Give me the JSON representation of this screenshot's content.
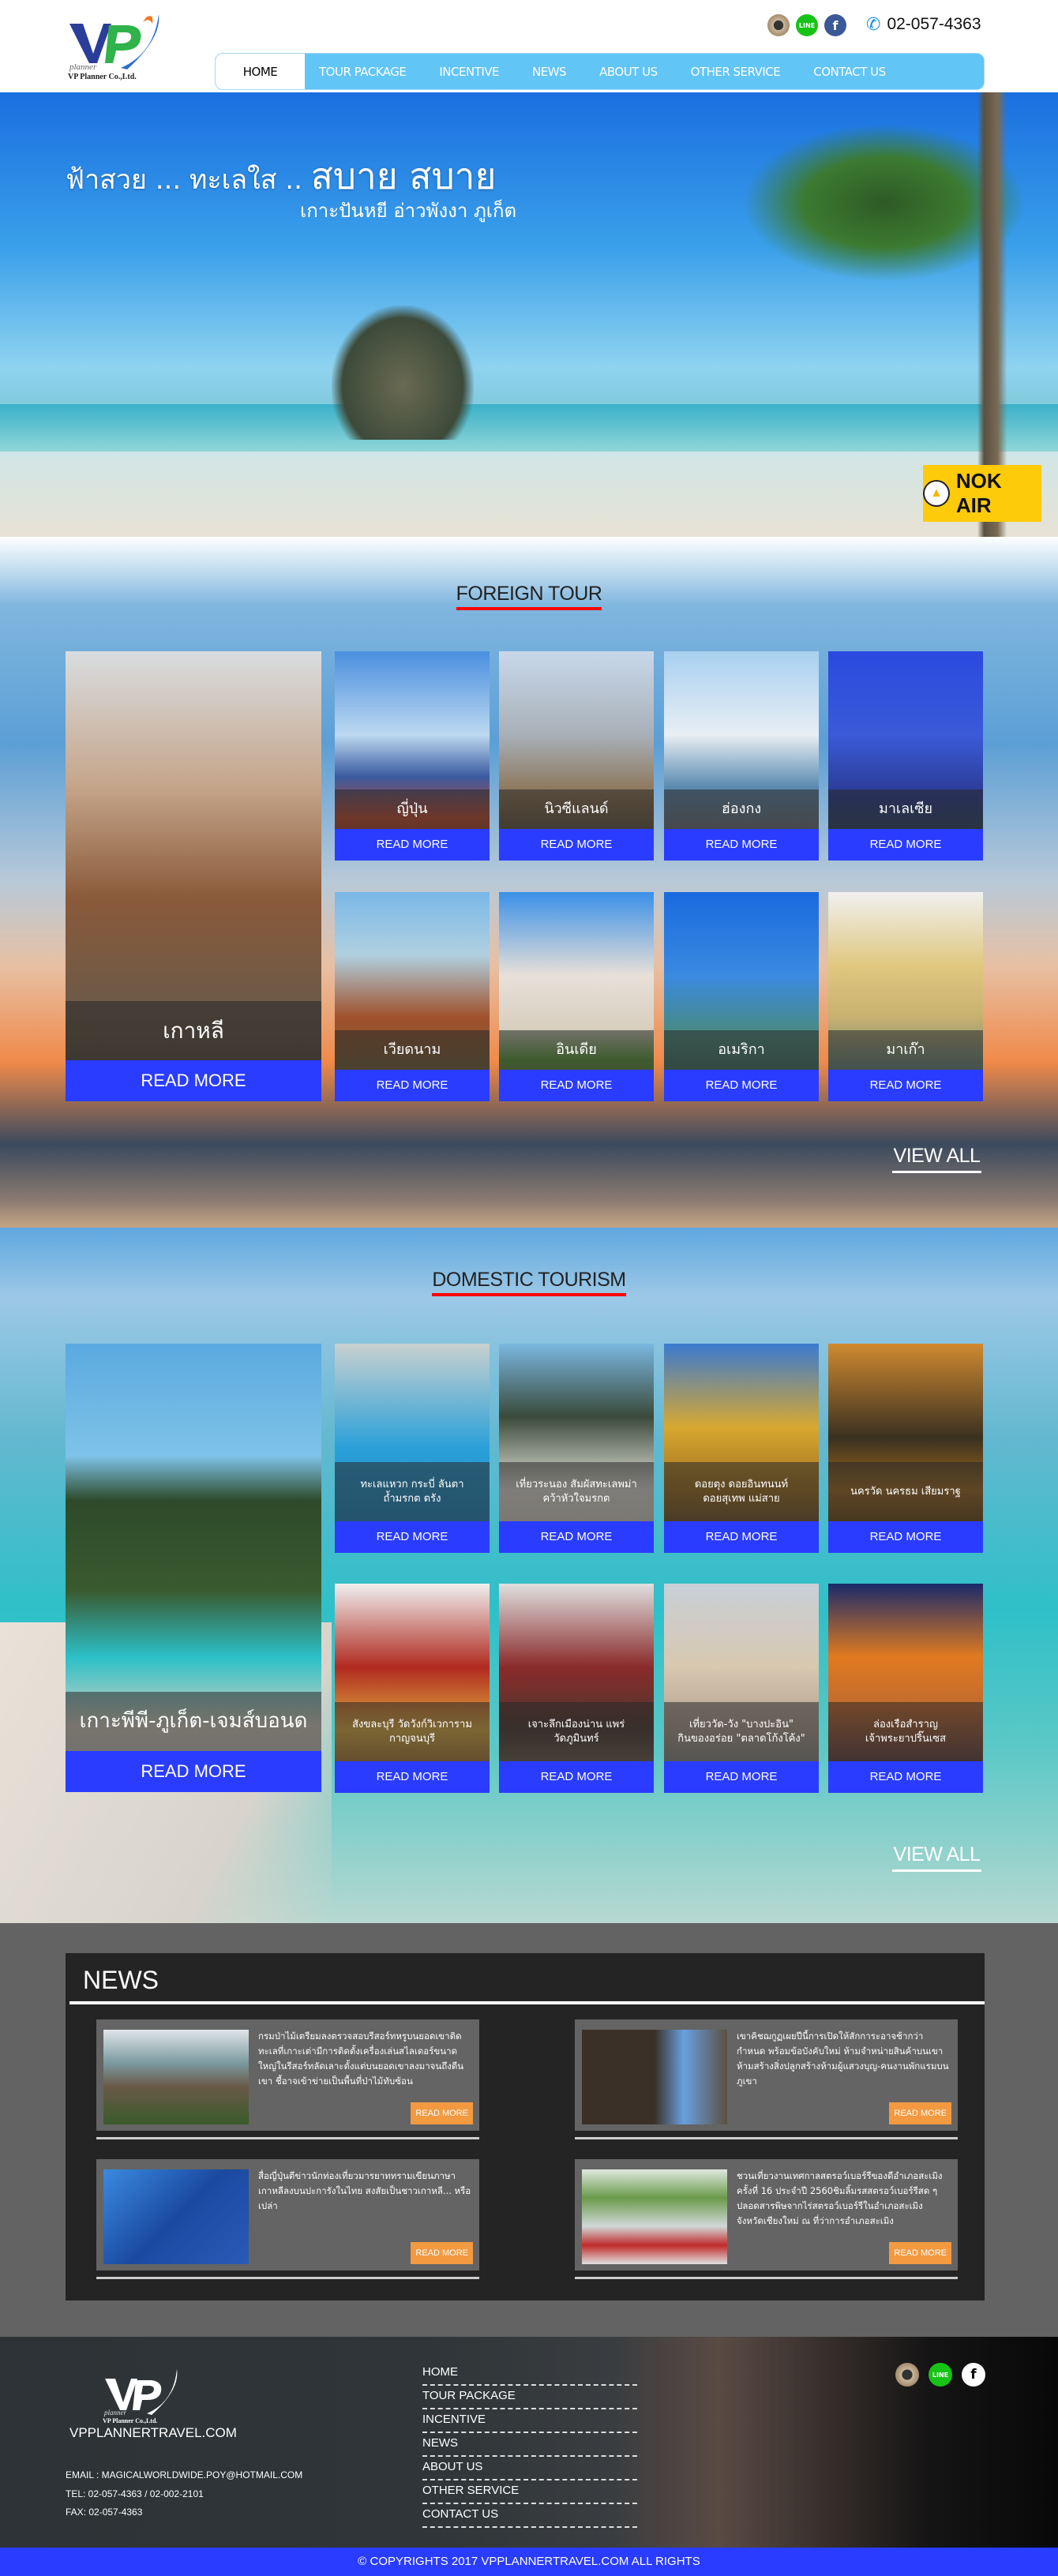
{
  "header": {
    "logo_text": "VP planner VP Planner Co.,Ltd.",
    "phone": "02-057-4363",
    "social": [
      "instagram-icon",
      "line-icon",
      "facebook-icon"
    ],
    "nav": [
      "HOME",
      "TOUR PACKAGE",
      "INCENTIVE",
      "NEWS",
      "ABOUT US",
      "OTHER SERVICE",
      "CONTACT US"
    ],
    "nav_active": "HOME",
    "nav_color": "#61c5f5"
  },
  "hero": {
    "line1_small": "ฟ้าสวย ... ทะเลใส ..",
    "line1_big": "สบาย สบาย",
    "line2": "เกาะปันหยี อ่าวพังงา   ภูเก็ต",
    "sponsor": "NOK AIR",
    "sponsor_color": "#fecb0b"
  },
  "foreign": {
    "title": "FOREIGN TOUR",
    "view_all": "VIEW ALL",
    "featured": {
      "name": "เกาหลี",
      "button": "READ MORE"
    },
    "cards": [
      {
        "name": "ญี่ปุ่น",
        "button": "READ MORE"
      },
      {
        "name": "นิวซีแลนด์",
        "button": "READ MORE"
      },
      {
        "name": "ฮ่องกง",
        "button": "READ MORE"
      },
      {
        "name": "มาเลเซีย",
        "button": "READ MORE"
      },
      {
        "name": "เวียดนาม",
        "button": "READ MORE"
      },
      {
        "name": "อินเดีย",
        "button": "READ MORE"
      },
      {
        "name": "อเมริกา",
        "button": "READ MORE"
      },
      {
        "name": "มาเก๊า",
        "button": "READ MORE"
      }
    ]
  },
  "domestic": {
    "title": "DOMESTIC TOURISM",
    "view_all": "VIEW ALL",
    "featured": {
      "name": "เกาะพีพี-ภูเก็ต-เจมส์บอนด",
      "button": "READ MORE"
    },
    "cards": [
      {
        "line1": "ทะเลแหวก กระบี่ ลันตา",
        "line2": "ถ้ำมรกต ตรัง",
        "button": "READ MORE"
      },
      {
        "line1": "เที่ยวระนอง สัมผัสทะเลพม่า",
        "line2": "คว้าหัวใจมรกต",
        "button": "READ MORE"
      },
      {
        "line1": "ดอยตุง ดอยอินทนนท์",
        "line2": "ดอยสุเทพ แม่สาย",
        "button": "READ MORE"
      },
      {
        "line1": "นครวัด นครธม เสียมราฐ",
        "line2": "",
        "button": "READ MORE"
      },
      {
        "line1": "สังขละบุรี วัดวังก์วิเวการาม",
        "line2": "กาญจนบุรี",
        "button": "READ MORE"
      },
      {
        "line1": "เจาะลึกเมืองน่าน แพร่",
        "line2": "วัดภูมินทร์",
        "button": "READ MORE"
      },
      {
        "line1": "เที่ยววัด-วัง \"บางปะอิน\"",
        "line2": "กินของอร่อย \"ตลาดโก้งโค้ง\"",
        "button": "READ MORE"
      },
      {
        "line1": "ล่องเรือสำราญ",
        "line2": "เจ้าพระยาปริ๊นเซส",
        "button": "READ MORE"
      }
    ]
  },
  "news": {
    "title": "NEWS",
    "items": [
      {
        "text": "กรมป่าไม้เตรียมลงตรวจสอบรีสอร์ทหรูบนยอดเขาติดทะเลที่เกาะเต่ามีการติดตั้งเครื่องเล่นสไลเดอร์ขนาดใหญ่ในรีสอร์ทลัดเลาะตั้งแต่บนยอดเขาลงมาจนถึงตีนเขา ชี้อาจเข้าข่ายเป็นพื้นที่ป่าไม้ทับซ้อน",
        "button": "READ MORE"
      },
      {
        "text": "เขาคิชฌกูฏเผยปีนี้การเปิดให้สักการะอาจช้ากว่ากำหนด พร้อมข้อบังคับใหม่ ห้ามจำหน่ายสินค้าบนเขา ห้ามสร้างสิ่งปลูกสร้างห้ามผู้แสวงบุญ-คนงานพักแรมบนภูเขา",
        "button": "READ MORE"
      },
      {
        "text": "สื่อญี่ปุ่นตีข่าวนักท่องเที่ยวมารยาททรามเขียนภาษาเกาหลีลงบนปะการังในไทย สงสัยเป็นชาวเกาหลี... หรือเปล่า",
        "button": "READ MORE"
      },
      {
        "text": "ชวนเที่ยวงานเทศกาลสตรอว์เบอร์รีของดีอำเภอสะเมิง ครั้งที่ 16 ประจำปี 2560ชิมลิ้มรสสตรอว์เบอร์รีสด ๆ ปลอดสารพิษจากไร่สตรอว์เบอร์รีในอำเภอสะเมิง จังหวัดเชียงใหม่ ณ ที่ว่าการอำเภอสะเมิง",
        "button": "READ MORE"
      }
    ],
    "button_color": "#f39a41"
  },
  "footer": {
    "logo_text": "VP planner VP Planner Co.,Ltd.",
    "site": "VPPLANNERTRAVEL.COM",
    "email": "EMAIL : MAGICALWORLDWIDE.POY@HOTMAIL.COM",
    "tel": "TEL: 02-057-4363 / 02-002-2101",
    "fax": "FAX: 02-057-4363",
    "nav": [
      "HOME",
      "TOUR PACKAGE",
      "INCENTIVE",
      "NEWS",
      "ABOUT US",
      "OTHER SERVICE",
      "CONTACT US"
    ],
    "social": [
      "instagram-icon",
      "line-icon",
      "facebook-icon"
    ],
    "copyright": "© COPYRIGHTS 2017 VPPLANNERTRAVEL.COM  ALL RIGHTS",
    "bar_color": "#2a3cff"
  }
}
